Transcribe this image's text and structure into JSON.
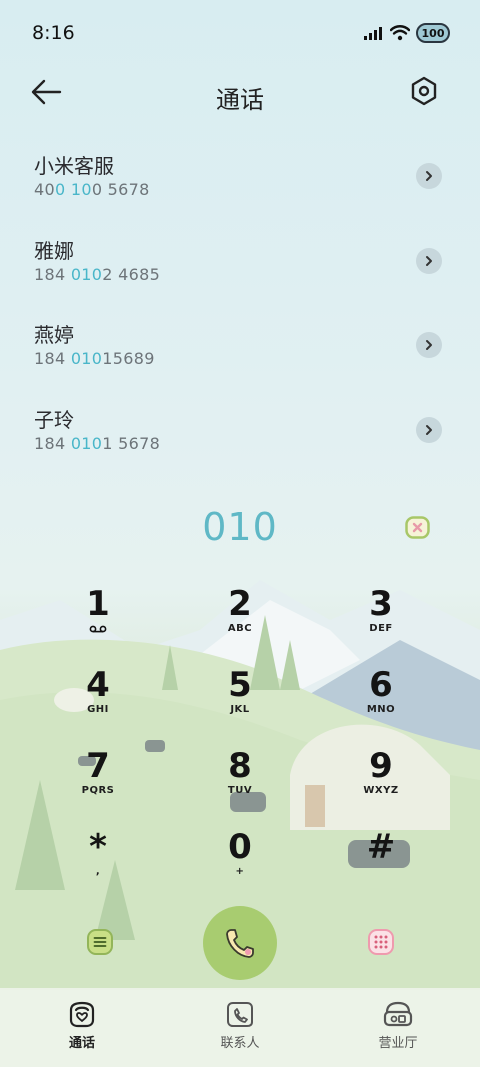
{
  "status_bar": {
    "time": "8:16",
    "battery": "100"
  },
  "header": {
    "title": "通话",
    "back_icon": "arrow-left-icon",
    "settings_icon": "hexagon-settings-icon"
  },
  "contacts": [
    {
      "name": "小米客服",
      "number_parts": [
        "40",
        "0",
        " ",
        "10",
        "0 5678"
      ]
    },
    {
      "name": "雅娜",
      "number_parts": [
        "184 ",
        "010",
        "2 4685"
      ]
    },
    {
      "name": "燕婷",
      "number_parts": [
        "184 ",
        "010",
        "15689"
      ]
    },
    {
      "name": "子玲",
      "number_parts": [
        "184 ",
        "010",
        "1 5678"
      ]
    }
  ],
  "dialer": {
    "input": "010",
    "keys": [
      {
        "digit": "1",
        "letters": ""
      },
      {
        "digit": "2",
        "letters": "ABC"
      },
      {
        "digit": "3",
        "letters": "DEF"
      },
      {
        "digit": "4",
        "letters": "GHI"
      },
      {
        "digit": "5",
        "letters": "JKL"
      },
      {
        "digit": "6",
        "letters": "MNO"
      },
      {
        "digit": "7",
        "letters": "PQRS"
      },
      {
        "digit": "8",
        "letters": "TUV"
      },
      {
        "digit": "9",
        "letters": "WXYZ"
      },
      {
        "digit": "*",
        "letters": ","
      },
      {
        "digit": "0",
        "letters": "+"
      },
      {
        "digit": "#",
        "letters": ""
      }
    ]
  },
  "bottom_nav": [
    {
      "label": "通话",
      "icon": "phone-tab-icon",
      "active": true
    },
    {
      "label": "联系人",
      "icon": "contacts-tab-icon",
      "active": false
    },
    {
      "label": "营业厅",
      "icon": "store-tab-icon",
      "active": false
    }
  ],
  "colors": {
    "accent": "#49b6c9",
    "call_button": "#a8cc70"
  }
}
